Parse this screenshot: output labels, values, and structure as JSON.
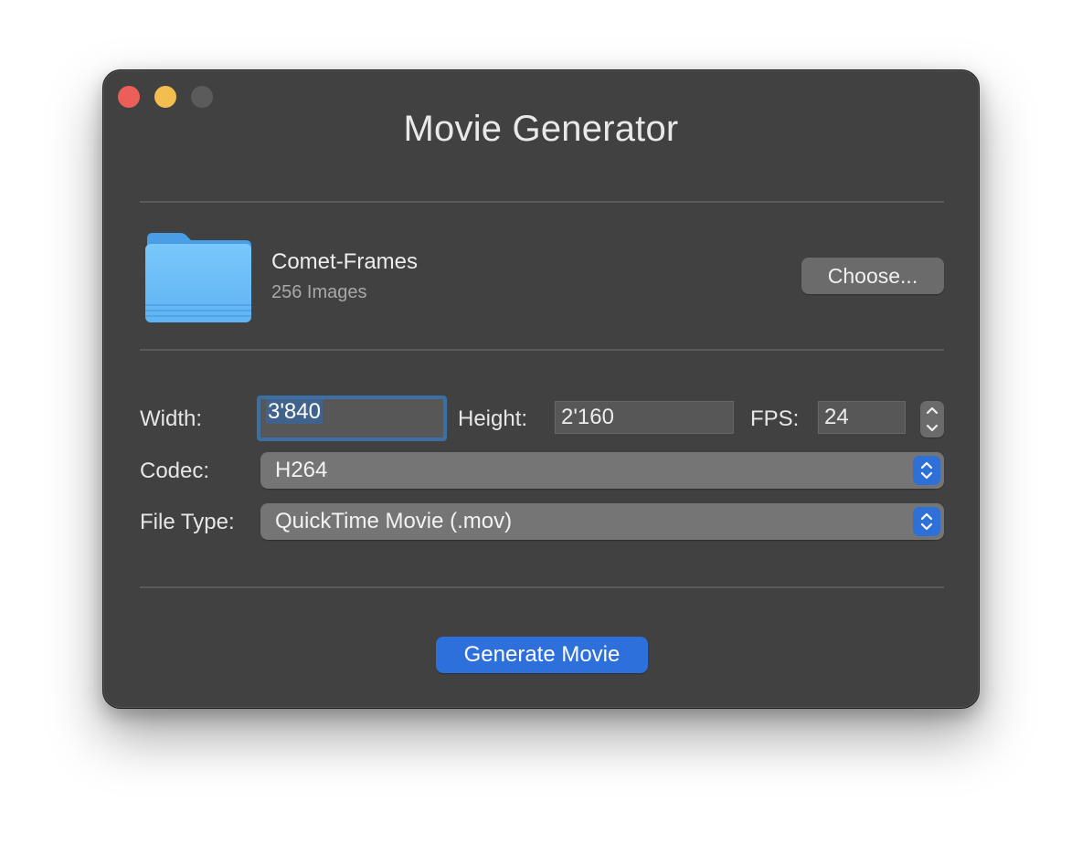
{
  "window": {
    "title": "Movie Generator"
  },
  "source": {
    "folder_name": "Comet-Frames",
    "image_count": "256 Images",
    "choose_label": "Choose..."
  },
  "settings": {
    "width_label": "Width:",
    "width_value": "3'840",
    "height_label": "Height:",
    "height_value": "2'160",
    "fps_label": "FPS:",
    "fps_value": "24",
    "codec_label": "Codec:",
    "codec_value": "H264",
    "filetype_label": "File Type:",
    "filetype_value": "QuickTime Movie (.mov)"
  },
  "actions": {
    "generate_label": "Generate Movie"
  },
  "icons": {
    "folder": "folder-icon",
    "stepper_up": "chevron-up-icon",
    "stepper_down": "chevron-down-icon",
    "popup": "up-down-chevron-icon"
  },
  "colors": {
    "accent": "#2d6fdb",
    "window_bg": "#414141",
    "close": "#ec5f58",
    "minimize": "#f4bd4f",
    "folder_blue": "#5bb4f6"
  }
}
